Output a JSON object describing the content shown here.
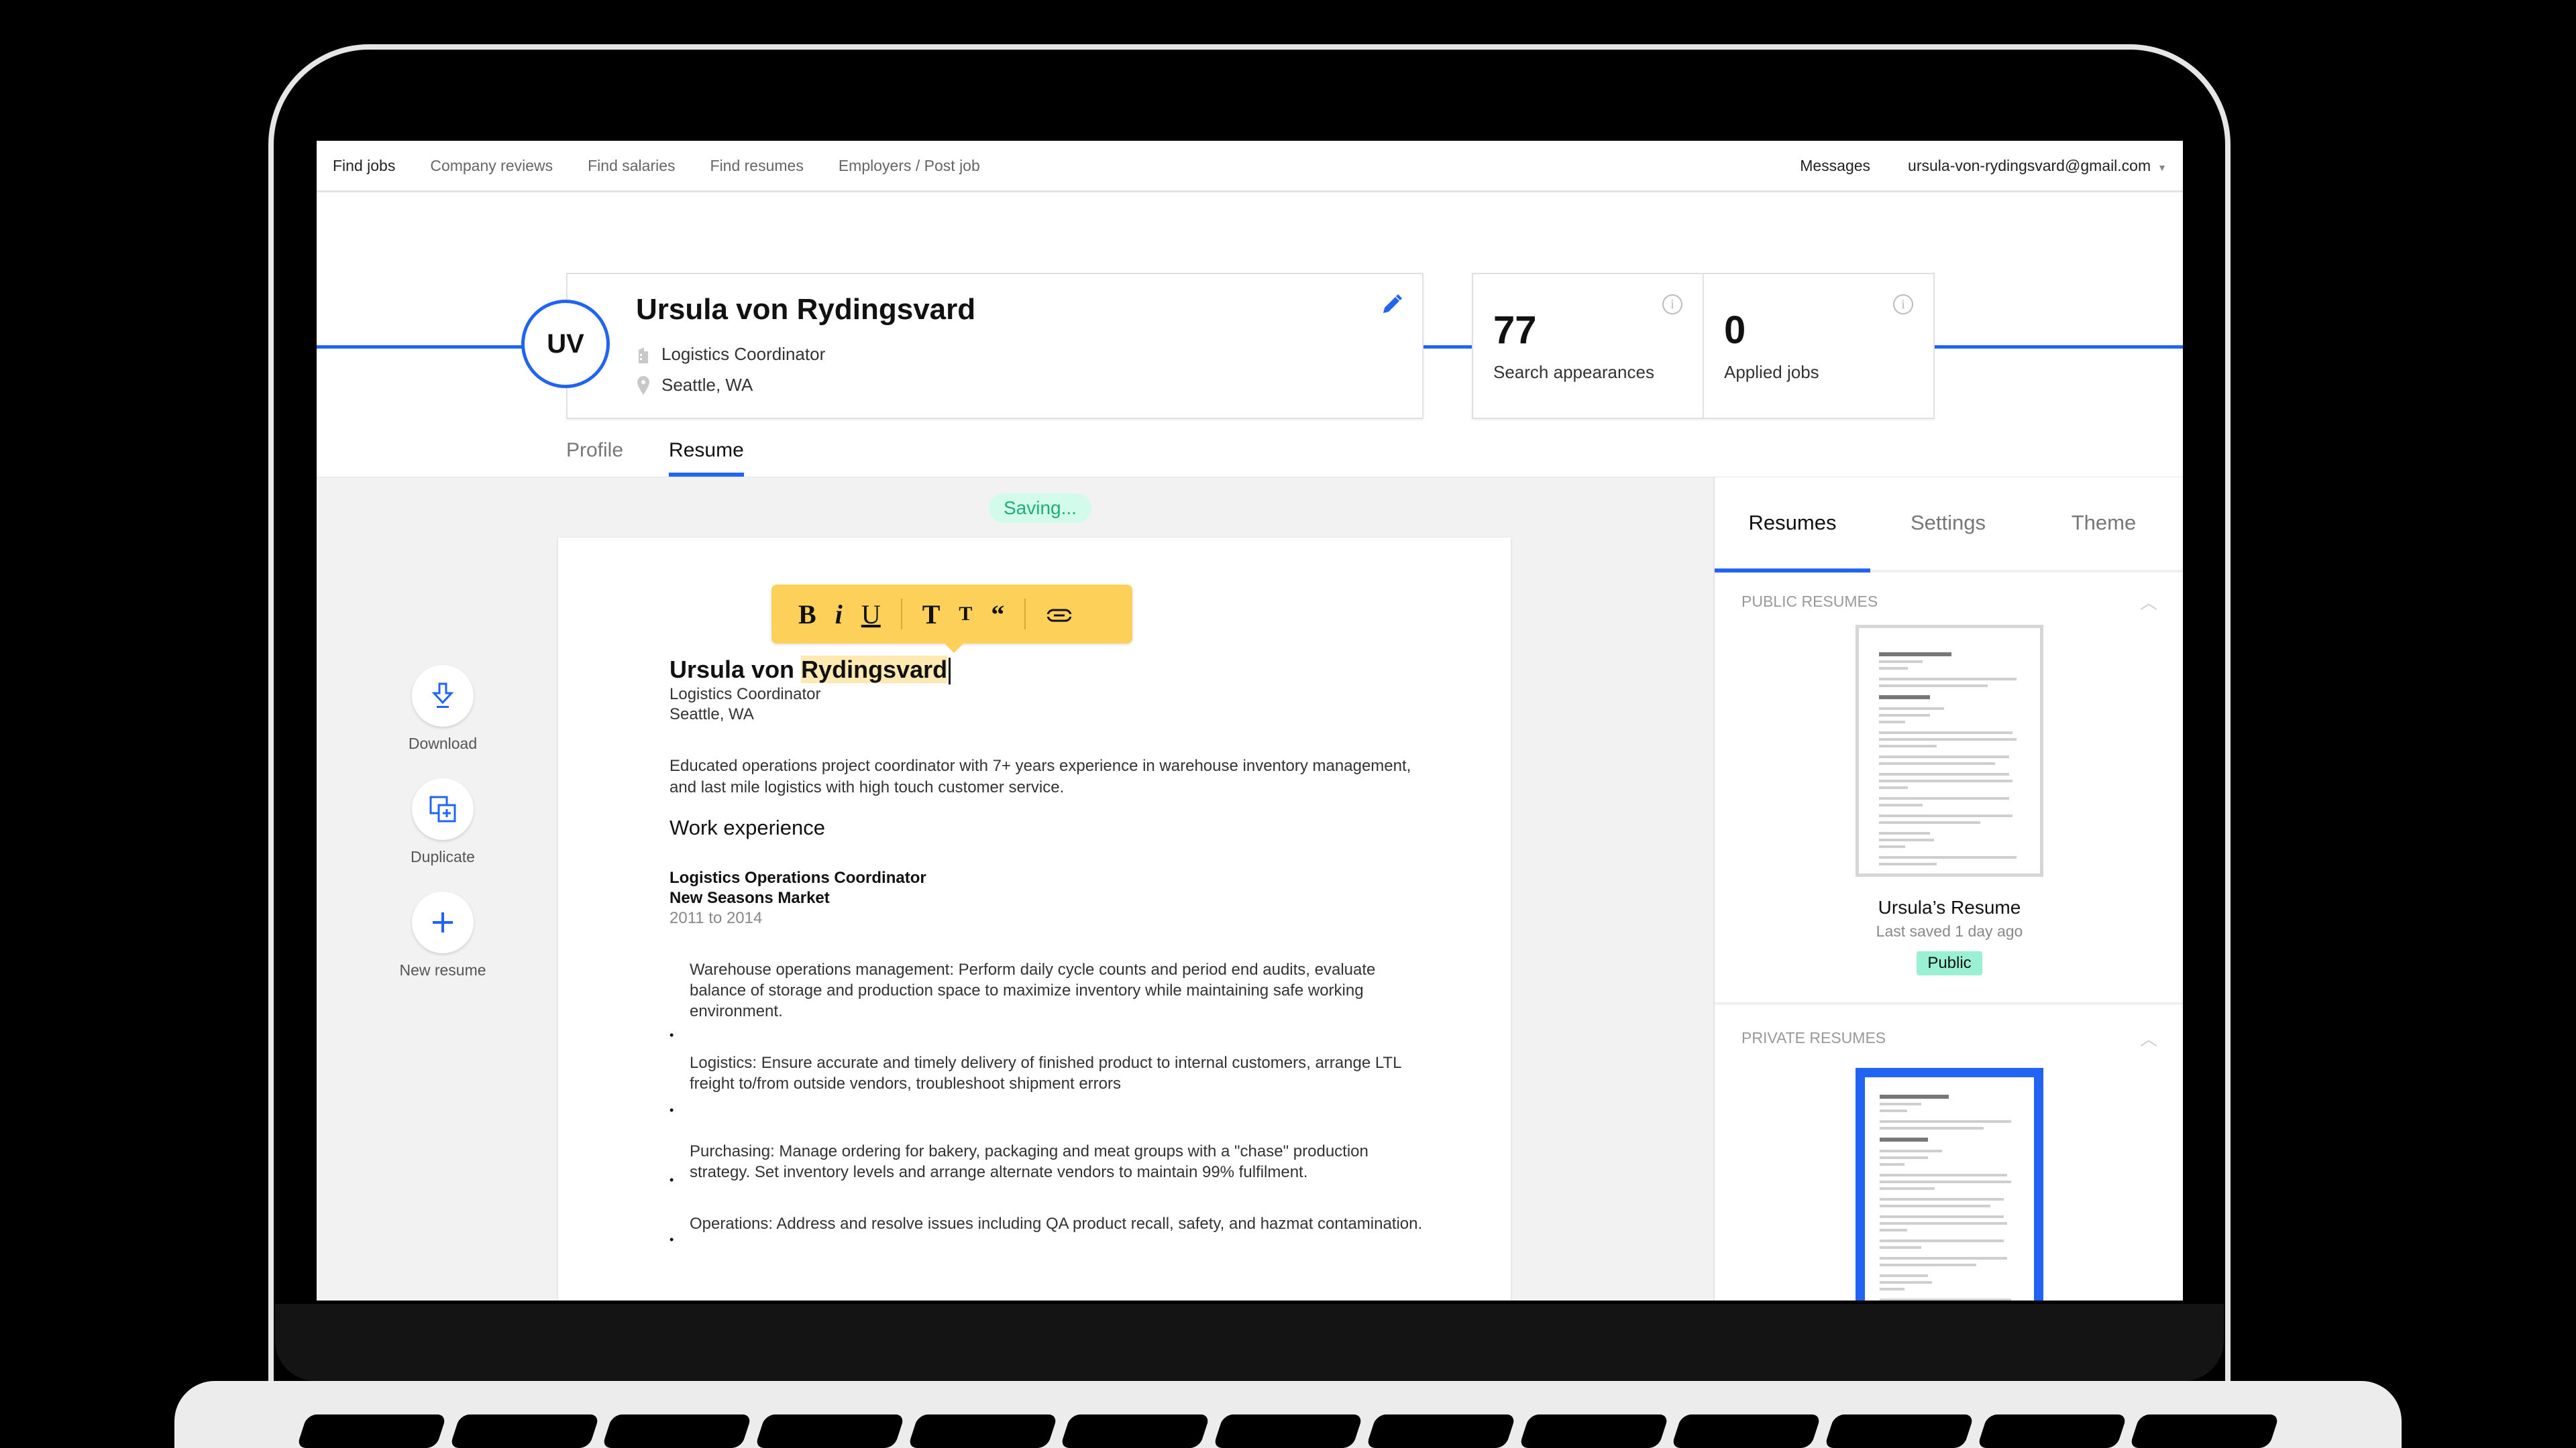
{
  "topnav": {
    "left": [
      "Find jobs",
      "Company reviews",
      "Find salaries",
      "Find resumes",
      "Employers / Post job"
    ],
    "messages": "Messages",
    "account": "ursula-von-rydingsvard@gmail.com"
  },
  "profile": {
    "initials": "UV",
    "name": "Ursula von Rydingsvard",
    "title": "Logistics Coordinator",
    "location": "Seattle, WA"
  },
  "stats": [
    {
      "value": "77",
      "label": "Search appearances"
    },
    {
      "value": "0",
      "label": "Applied jobs"
    }
  ],
  "tabs": [
    "Profile",
    "Resume"
  ],
  "active_tab": "Resume",
  "status": "Saving...",
  "actions": [
    "Download",
    "Duplicate",
    "New resume"
  ],
  "toolbar": {
    "bold": "B",
    "italic": "i",
    "underline": "U",
    "heading_large": "T",
    "heading_small": "T",
    "quote": "“"
  },
  "resume": {
    "name_first": "Ursula von ",
    "name_selected": "Rydingsvard",
    "title": "Logistics Coordinator",
    "location": "Seattle, WA",
    "summary": "Educated operations project coordinator with 7+ years experience in warehouse inventory management, and last mile logistics with high touch customer service.",
    "section_heading": "Work experience",
    "job": {
      "title": "Logistics Operations Coordinator",
      "company": "New Seasons Market",
      "dates": "2011 to 2014",
      "bullets": [
        "Warehouse operations management: Perform daily cycle counts and period end audits, evaluate balance of storage and production space to maximize inventory while maintaining safe working environment.",
        "Logistics: Ensure accurate and timely delivery of finished product to internal customers, arrange LTL freight to/from outside vendors, troubleshoot shipment errors",
        "Purchasing: Manage ordering for bakery, packaging and meat groups with a \"chase\" production strategy. Set inventory levels and arrange alternate vendors to maintain 99% fulfilment.",
        "Operations: Address and resolve issues including QA product recall, safety, and hazmat contamination."
      ]
    }
  },
  "side": {
    "tabs": [
      "Resumes",
      "Settings",
      "Theme"
    ],
    "active_tab": "Resumes",
    "public_heading": "PUBLIC RESUMES",
    "private_heading": "PRIVATE RESUMES",
    "public_resume": {
      "title": "Ursula’s Resume",
      "saved": "Last saved 1 day ago",
      "badge": "Public"
    }
  },
  "colors": {
    "accent": "#2164f3",
    "toolbar": "#fdd05a",
    "saving_bg": "#d2fbeb",
    "saving_text": "#1fae77",
    "public_badge": "#99f0d2"
  }
}
